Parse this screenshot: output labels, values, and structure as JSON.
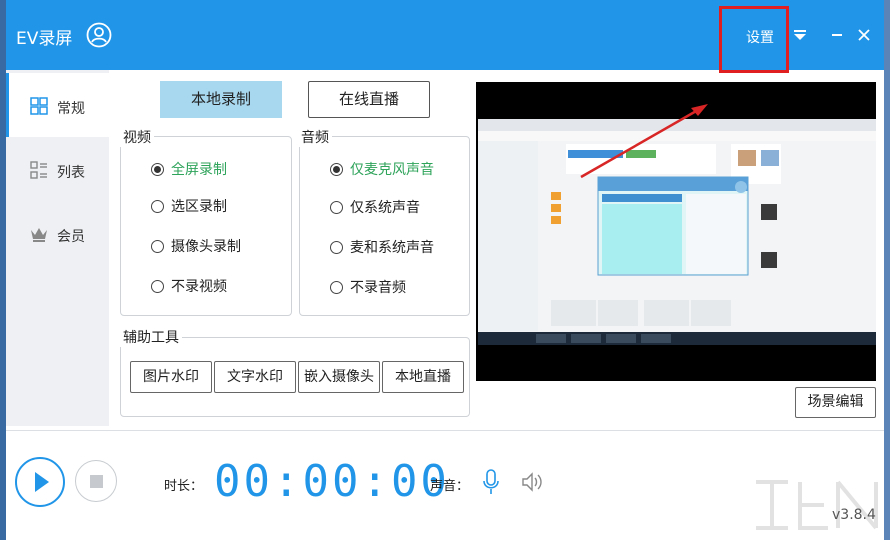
{
  "window": {
    "title": "EV录屏",
    "settings_label": "设置",
    "version": "v3.8.4"
  },
  "sidebar": {
    "items": [
      {
        "label": "常规",
        "icon": "grid-icon",
        "active": true
      },
      {
        "label": "列表",
        "icon": "list-icon",
        "active": false
      },
      {
        "label": "会员",
        "icon": "crown-icon",
        "active": false
      }
    ]
  },
  "modes": {
    "local": "本地录制",
    "live": "在线直播"
  },
  "video": {
    "title": "视频",
    "options": [
      "全屏录制",
      "选区录制",
      "摄像头录制",
      "不录视频"
    ],
    "selected": 0
  },
  "audio": {
    "title": "音频",
    "options": [
      "仅麦克风声音",
      "仅系统声音",
      "麦和系统声音",
      "不录音频"
    ],
    "selected": 0
  },
  "tools": {
    "title": "辅助工具",
    "buttons": [
      "图片水印",
      "文字水印",
      "嵌入摄像头",
      "本地直播"
    ]
  },
  "preview": {
    "scene_button": "场景编辑"
  },
  "bottom": {
    "duration_label": "时长：",
    "timer": "00:00:00",
    "sound_label": "声音："
  },
  "colors": {
    "accent": "#2196e8",
    "selected_text": "#2ea35a",
    "highlight": "#e02020"
  }
}
